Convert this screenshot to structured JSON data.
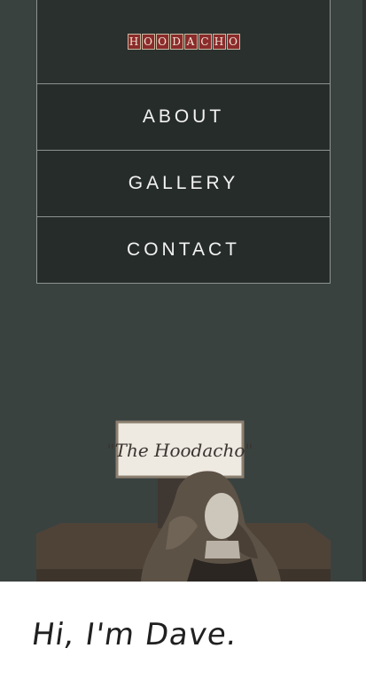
{
  "logo": {
    "letters": [
      "H",
      "O",
      "O",
      "D",
      "A",
      "C",
      "H",
      "O"
    ]
  },
  "nav": {
    "about": "ABOUT",
    "gallery": "GALLERY",
    "contact": "CONTACT"
  },
  "hero": {
    "sign_text": "\"The Hoodacho\""
  },
  "intro": {
    "greeting": "Hi, I'm Dave."
  }
}
